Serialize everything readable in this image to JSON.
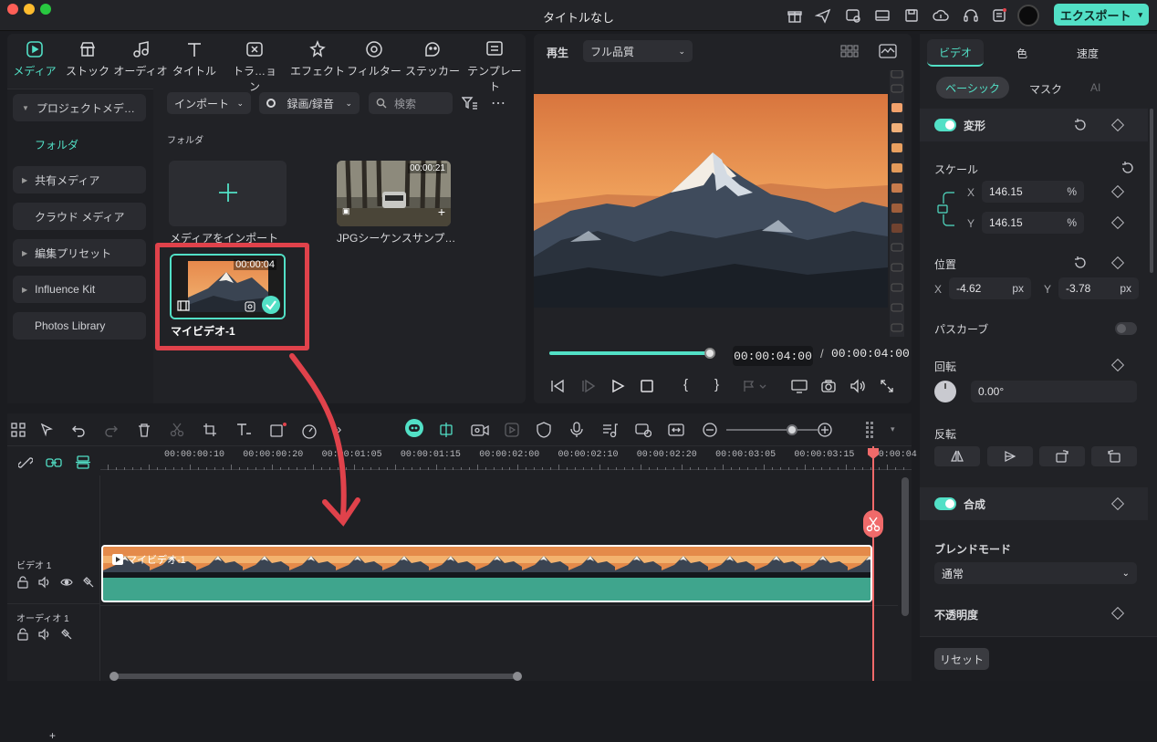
{
  "window": {
    "title": "タイトルなし",
    "export_label": "エクスポート"
  },
  "media_tabs": [
    {
      "label": "メディア",
      "icon": "media-icon"
    },
    {
      "label": "ストック",
      "icon": "stock-icon"
    },
    {
      "label": "オーディオ",
      "icon": "audio-icon"
    },
    {
      "label": "タイトル",
      "icon": "title-icon"
    },
    {
      "label": "トラ…ョン",
      "icon": "transition-icon"
    },
    {
      "label": "エフェクト",
      "icon": "effect-icon"
    },
    {
      "label": "フィルター",
      "icon": "filter-icon"
    },
    {
      "label": "ステッカー",
      "icon": "sticker-icon"
    },
    {
      "label": "テンプレート",
      "icon": "template-icon"
    }
  ],
  "sidebar": {
    "items": [
      {
        "label": "プロジェクトメデ…",
        "caret": "▼"
      },
      {
        "label": "フォルダ"
      },
      {
        "label": "共有メディア",
        "caret": "▶"
      },
      {
        "label": "クラウド メディア"
      },
      {
        "label": "編集プリセット",
        "caret": "▶"
      },
      {
        "label": "Influence Kit",
        "caret": "▶"
      },
      {
        "label": "Photos Library"
      }
    ]
  },
  "media_toolbar": {
    "import_label": "インポート",
    "record_label": "録画/録音",
    "search_placeholder": "検索"
  },
  "media_library": {
    "folder_label": "フォルダ",
    "items": [
      {
        "name": "メディアをインポート"
      },
      {
        "name": "JPGシーケンスサンプ…",
        "duration": "00:00:21"
      },
      {
        "name": "マイビデオ-1",
        "duration": "00:00:04"
      }
    ]
  },
  "preview": {
    "play_label": "再生",
    "quality": "フル品質",
    "current_time": "00:00:04:00",
    "separator": "/",
    "total_time": "00:00:04:00",
    "progress": 1.0
  },
  "timeline": {
    "ruler_labels": [
      "00:00:00:10",
      "00:00:00:20",
      "00:00:01:05",
      "00:00:01:15",
      "00:00:02:00",
      "00:00:02:10",
      "00:00:02:20",
      "00:00:03:05",
      "00:00:03:15",
      "00:00:04"
    ],
    "tracks": [
      {
        "label": "ビデオ 1"
      },
      {
        "label": "オーディオ 1"
      }
    ],
    "clip_name": "マイビデオ-1",
    "zoom_level": 0.72
  },
  "inspector": {
    "tabs": [
      "ビデオ",
      "色",
      "速度"
    ],
    "subtabs": [
      "ベーシック",
      "マスク",
      "AI"
    ],
    "transform_label": "変形",
    "scale_label": "スケール",
    "scale_x": "146.15",
    "scale_y": "146.15",
    "percent": "%",
    "position_label": "位置",
    "pos_x": "-4.62",
    "pos_y": "-3.78",
    "px": "px",
    "x": "X",
    "y": "Y",
    "path_curve_label": "パスカーブ",
    "rotation_label": "回転",
    "rotation_value": "0.00°",
    "flip_label": "反転",
    "composite_label": "合成",
    "blend_mode_label": "ブレンドモード",
    "blend_mode_value": "通常",
    "opacity_label": "不透明度",
    "reset_label": "リセット"
  },
  "colors": {
    "accent": "#52e0c6",
    "highlight_red": "#e0424b",
    "playhead": "#f06a6a"
  }
}
